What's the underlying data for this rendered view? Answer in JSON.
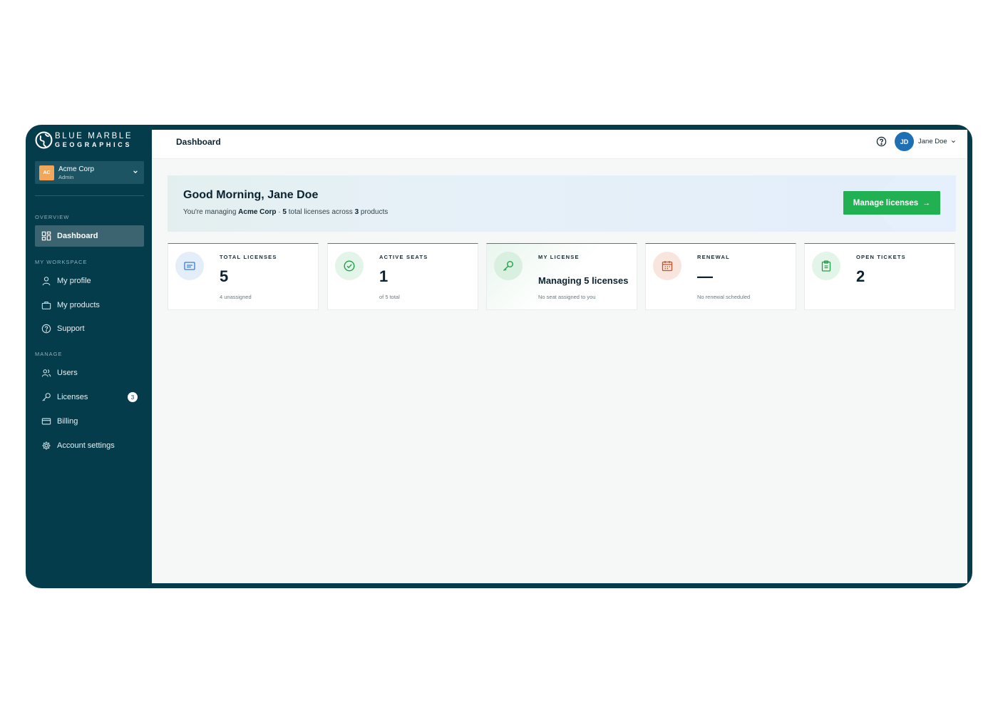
{
  "brand": {
    "line1": "BLUE MARBLE",
    "line2": "GEOGRAPHICS"
  },
  "org": {
    "initials": "AC",
    "name": "Acme Corp",
    "role": "Admin"
  },
  "sidebar": {
    "sections": {
      "overview": "OVERVIEW",
      "workspace": "MY WORKSPACE",
      "manage": "MANAGE"
    },
    "items": {
      "dashboard": "Dashboard",
      "profile": "My profile",
      "products": "My products",
      "support": "Support",
      "users": "Users",
      "licenses": "Licenses",
      "billing": "Billing",
      "settings": "Account settings"
    },
    "licenses_badge": "3"
  },
  "topbar": {
    "title": "Dashboard",
    "user_initials": "JD",
    "user_name": "Jane Doe"
  },
  "welcome": {
    "greeting": "Good Morning, Jane Doe",
    "sub_prefix": "You're managing ",
    "org": "Acme Corp",
    "sub_mid1": " · ",
    "licenses": "5",
    "sub_mid2": " total licenses across ",
    "products": "3",
    "sub_suffix": " products",
    "button": "Manage licenses"
  },
  "cards": [
    {
      "label": "TOTAL LICENSES",
      "value": "5",
      "sub": "4 unassigned",
      "accent": "#3a7bd5",
      "icon_bg": "#e4eef9",
      "icon_color": "#3a7bd5"
    },
    {
      "label": "ACTIVE SEATS",
      "value": "1",
      "sub": "of 5 total",
      "accent": "#21a04a",
      "icon_bg": "#e3f4e8",
      "icon_color": "#21a04a"
    },
    {
      "label": "MY LICENSE",
      "value": "Managing 5 licenses",
      "sub": "No seat assigned to you",
      "accent": "#21a04a",
      "icon_bg": "#d9efe0",
      "icon_color": "#21a04a"
    },
    {
      "label": "RENEWAL",
      "value": "—",
      "sub": "No renewal scheduled",
      "accent": "#b84a1f",
      "icon_bg": "#f8e5dd",
      "icon_color": "#c8532a"
    },
    {
      "label": "OPEN TICKETS",
      "value": "2",
      "sub": "",
      "accent": "#21a04a",
      "icon_bg": "#e3f4e8",
      "icon_color": "#21a04a"
    }
  ]
}
